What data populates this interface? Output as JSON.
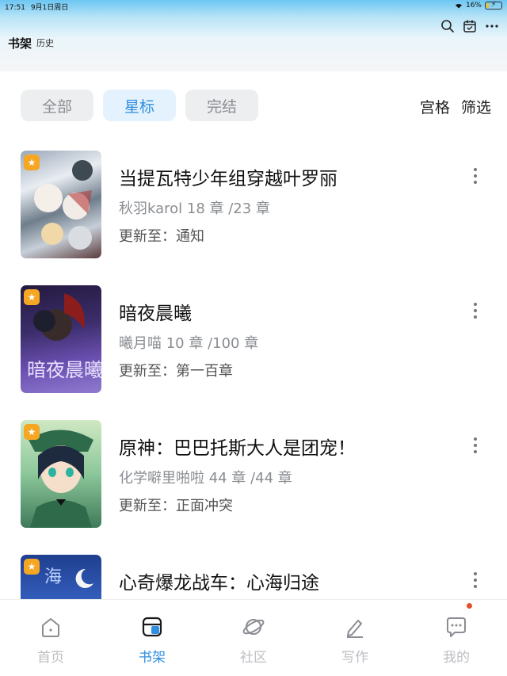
{
  "status_bar": {
    "time": "17:51",
    "date": "9月1日周日",
    "battery": "16%",
    "battery_fraction": 0.16
  },
  "header": {
    "title": "书架",
    "subtitle": "历史",
    "icons": [
      "search-icon",
      "calendar-check-icon",
      "more-horizontal-icon"
    ]
  },
  "filters": {
    "tabs": [
      {
        "label": "全部",
        "active": false
      },
      {
        "label": "星标",
        "active": true
      },
      {
        "label": "完结",
        "active": false
      }
    ],
    "grid_label": "宫格",
    "filter_label": "筛选"
  },
  "books": [
    {
      "title": "当提瓦特少年组穿越叶罗丽",
      "meta": "秋羽karol  18 章 /23 章",
      "update": "更新至：通知",
      "starred": true
    },
    {
      "title": "暗夜晨曦",
      "meta": "曦月喵  10 章 /100 章",
      "update": "更新至：第一百章",
      "starred": true
    },
    {
      "title": "原神：巴巴托斯大人是团宠！",
      "meta": "化学噼里啪啦  44 章 /44 章",
      "update": "更新至：正面冲突",
      "starred": true
    },
    {
      "title": "心奇爆龙战车：心海归途",
      "meta": "",
      "update": "",
      "starred": true
    }
  ],
  "bottom_nav": [
    {
      "label": "首页",
      "icon": "home-icon",
      "active": false
    },
    {
      "label": "书架",
      "icon": "bookshelf-icon",
      "active": true
    },
    {
      "label": "社区",
      "icon": "planet-icon",
      "active": false
    },
    {
      "label": "写作",
      "icon": "pen-icon",
      "active": false
    },
    {
      "label": "我的",
      "icon": "chat-bubble-icon",
      "active": false,
      "badge": true
    }
  ],
  "colors": {
    "accent": "#2f8ee0",
    "star_badge": "#f5a623",
    "notification_dot": "#e8502a"
  }
}
